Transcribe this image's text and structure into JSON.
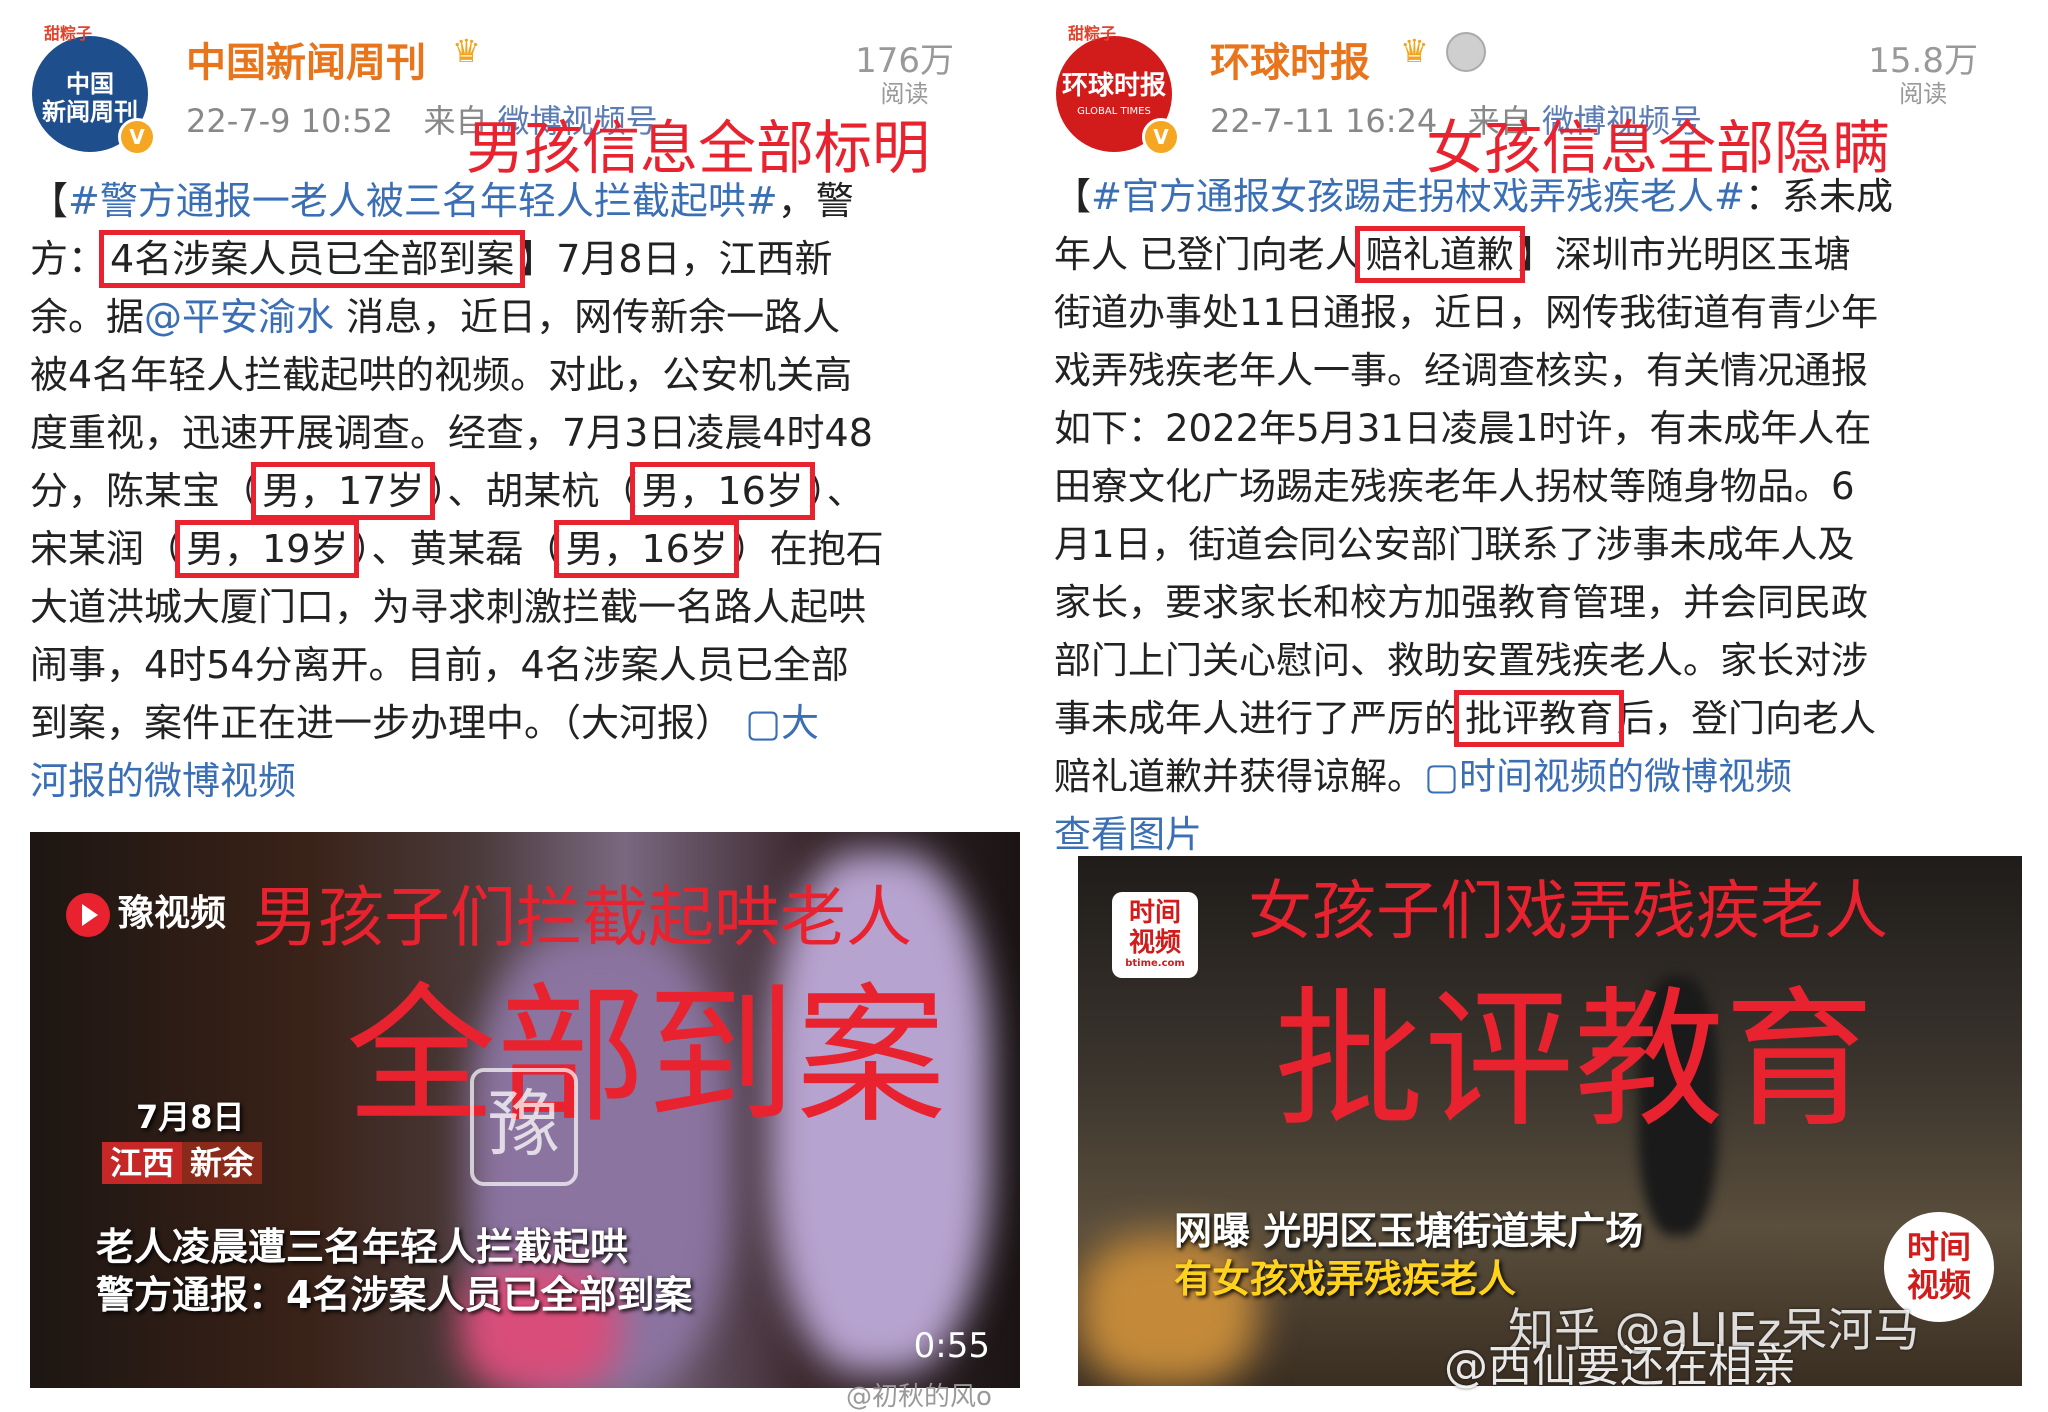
{
  "left_post": {
    "avatar_text": "中国\n新闻周刊",
    "avatar_badge": "甜粽子",
    "username": "中国新闻周刊",
    "time": "22-7-9 10:52",
    "from_label": "来自",
    "source": "微博视频号",
    "reads_count": "176万",
    "reads_label": "阅读",
    "annotation": "男孩信息全部标明",
    "lines": [
      [
        {
          "t": "【"
        },
        {
          "t": "#警方通报一老人被三名年轻人拦截起哄#",
          "c": "blue"
        },
        {
          "t": "，警"
        }
      ],
      [
        {
          "t": "方："
        },
        {
          "t": "4名涉案人员已全部到案",
          "c": "hl"
        },
        {
          "t": "】7月8日，江西新"
        }
      ],
      [
        {
          "t": "余。据"
        },
        {
          "t": "@平安渝水",
          "c": "blue"
        },
        {
          "t": " 消息，近日，网传新余一路人"
        }
      ],
      [
        {
          "t": "被4名年轻人拦截起哄的视频。对此，公安机关高"
        }
      ],
      [
        {
          "t": "度重视，迅速开展调查。经查，7月3日凌晨4时48"
        }
      ],
      [
        {
          "t": "分，陈某宝（"
        },
        {
          "t": "男，17岁",
          "c": "hl"
        },
        {
          "t": "）、胡某杭（"
        },
        {
          "t": "男，16岁",
          "c": "hl"
        },
        {
          "t": "）、"
        }
      ],
      [
        {
          "t": "宋某润（"
        },
        {
          "t": "男，19岁",
          "c": "hl"
        },
        {
          "t": "）、黄某磊（"
        },
        {
          "t": "男，16岁",
          "c": "hl"
        },
        {
          "t": "）在抱石"
        }
      ],
      [
        {
          "t": "大道洪城大厦门口，为寻求刺激拦截一名路人起哄"
        }
      ],
      [
        {
          "t": "闹事，4时54分离开。目前，4名涉案人员已全部"
        }
      ],
      [
        {
          "t": "到案，案件正在进一步办理中。（大河报） "
        },
        {
          "t": "▢大",
          "c": "blue"
        }
      ],
      [
        {
          "t": "河报的微博视频",
          "c": "blue"
        }
      ]
    ],
    "video": {
      "logo": "豫视频",
      "overlay_top": "男孩子们拦截起哄老人",
      "overlay_big": "全部到案",
      "stamp": "豫",
      "date": "7月8日",
      "loc_a": "江西",
      "loc_b": "新余",
      "caption1": "老人凌晨遭三名年轻人拦截起哄",
      "caption2": "警方通报：4名涉案人员已全部到案",
      "duration": "0:55",
      "watermark": "@初秋的风o"
    }
  },
  "right_post": {
    "avatar_text": "环球时报",
    "avatar_sub": "GLOBAL TIMES",
    "avatar_badge": "甜粽子",
    "username": "环球时报",
    "time": "22-7-11 16:24",
    "from_label": "来自",
    "source": "微博视频号",
    "reads_count": "15.8万",
    "reads_label": "阅读",
    "annotation": "女孩信息全部隐瞒",
    "lines": [
      [
        {
          "t": "【"
        },
        {
          "t": "#官方通报女孩踢走拐杖戏弄残疾老人#",
          "c": "blue"
        },
        {
          "t": "：系未成"
        }
      ],
      [
        {
          "t": "年人 已登门向老人"
        },
        {
          "t": "赔礼道歉",
          "c": "hl"
        },
        {
          "t": "】深圳市光明区玉塘"
        }
      ],
      [
        {
          "t": "街道办事处11日通报，近日，网传我街道有青少年"
        }
      ],
      [
        {
          "t": "戏弄残疾老年人一事。经调查核实，有关情况通报"
        }
      ],
      [
        {
          "t": "如下：2022年5月31日凌晨1时许，有未成年人在"
        }
      ],
      [
        {
          "t": "田寮文化广场踢走残疾老年人拐杖等随身物品。6"
        }
      ],
      [
        {
          "t": "月1日，街道会同公安部门联系了涉事未成年人及"
        }
      ],
      [
        {
          "t": "家长，要求家长和校方加强教育管理，并会同民政"
        }
      ],
      [
        {
          "t": "部门上门关心慰问、救助安置残疾老人。家长对涉"
        }
      ],
      [
        {
          "t": "事未成年人进行了严厉的"
        },
        {
          "t": "批评教育",
          "c": "hl"
        },
        {
          "t": "后，登门向老人"
        }
      ],
      [
        {
          "t": "赔礼道歉并获得谅解。"
        },
        {
          "t": "▢时间视频的微博视频",
          "c": "blue"
        }
      ],
      [
        {
          "t": "查看图片",
          "c": "blue"
        }
      ]
    ],
    "video": {
      "logo_top": "时间",
      "logo_bottom": "视频",
      "logo_url": "btime.com",
      "overlay_top": "女孩子们戏弄残疾老人",
      "overlay_big": "批评教育",
      "caption1": "网曝 光明区玉塘街道某广场",
      "caption2": "有女孩戏弄残疾老人",
      "round_logo_top": "时间",
      "round_logo_bottom": "视频",
      "watermark1": "知乎 @aLIEz呆河马",
      "watermark2": "@西仙要还在相亲"
    }
  },
  "colors": {
    "annotation_red": "#e8232f",
    "username_orange": "#e8741c",
    "link_blue": "#3b6fb5",
    "caption_yellow": "#ffd21e"
  }
}
